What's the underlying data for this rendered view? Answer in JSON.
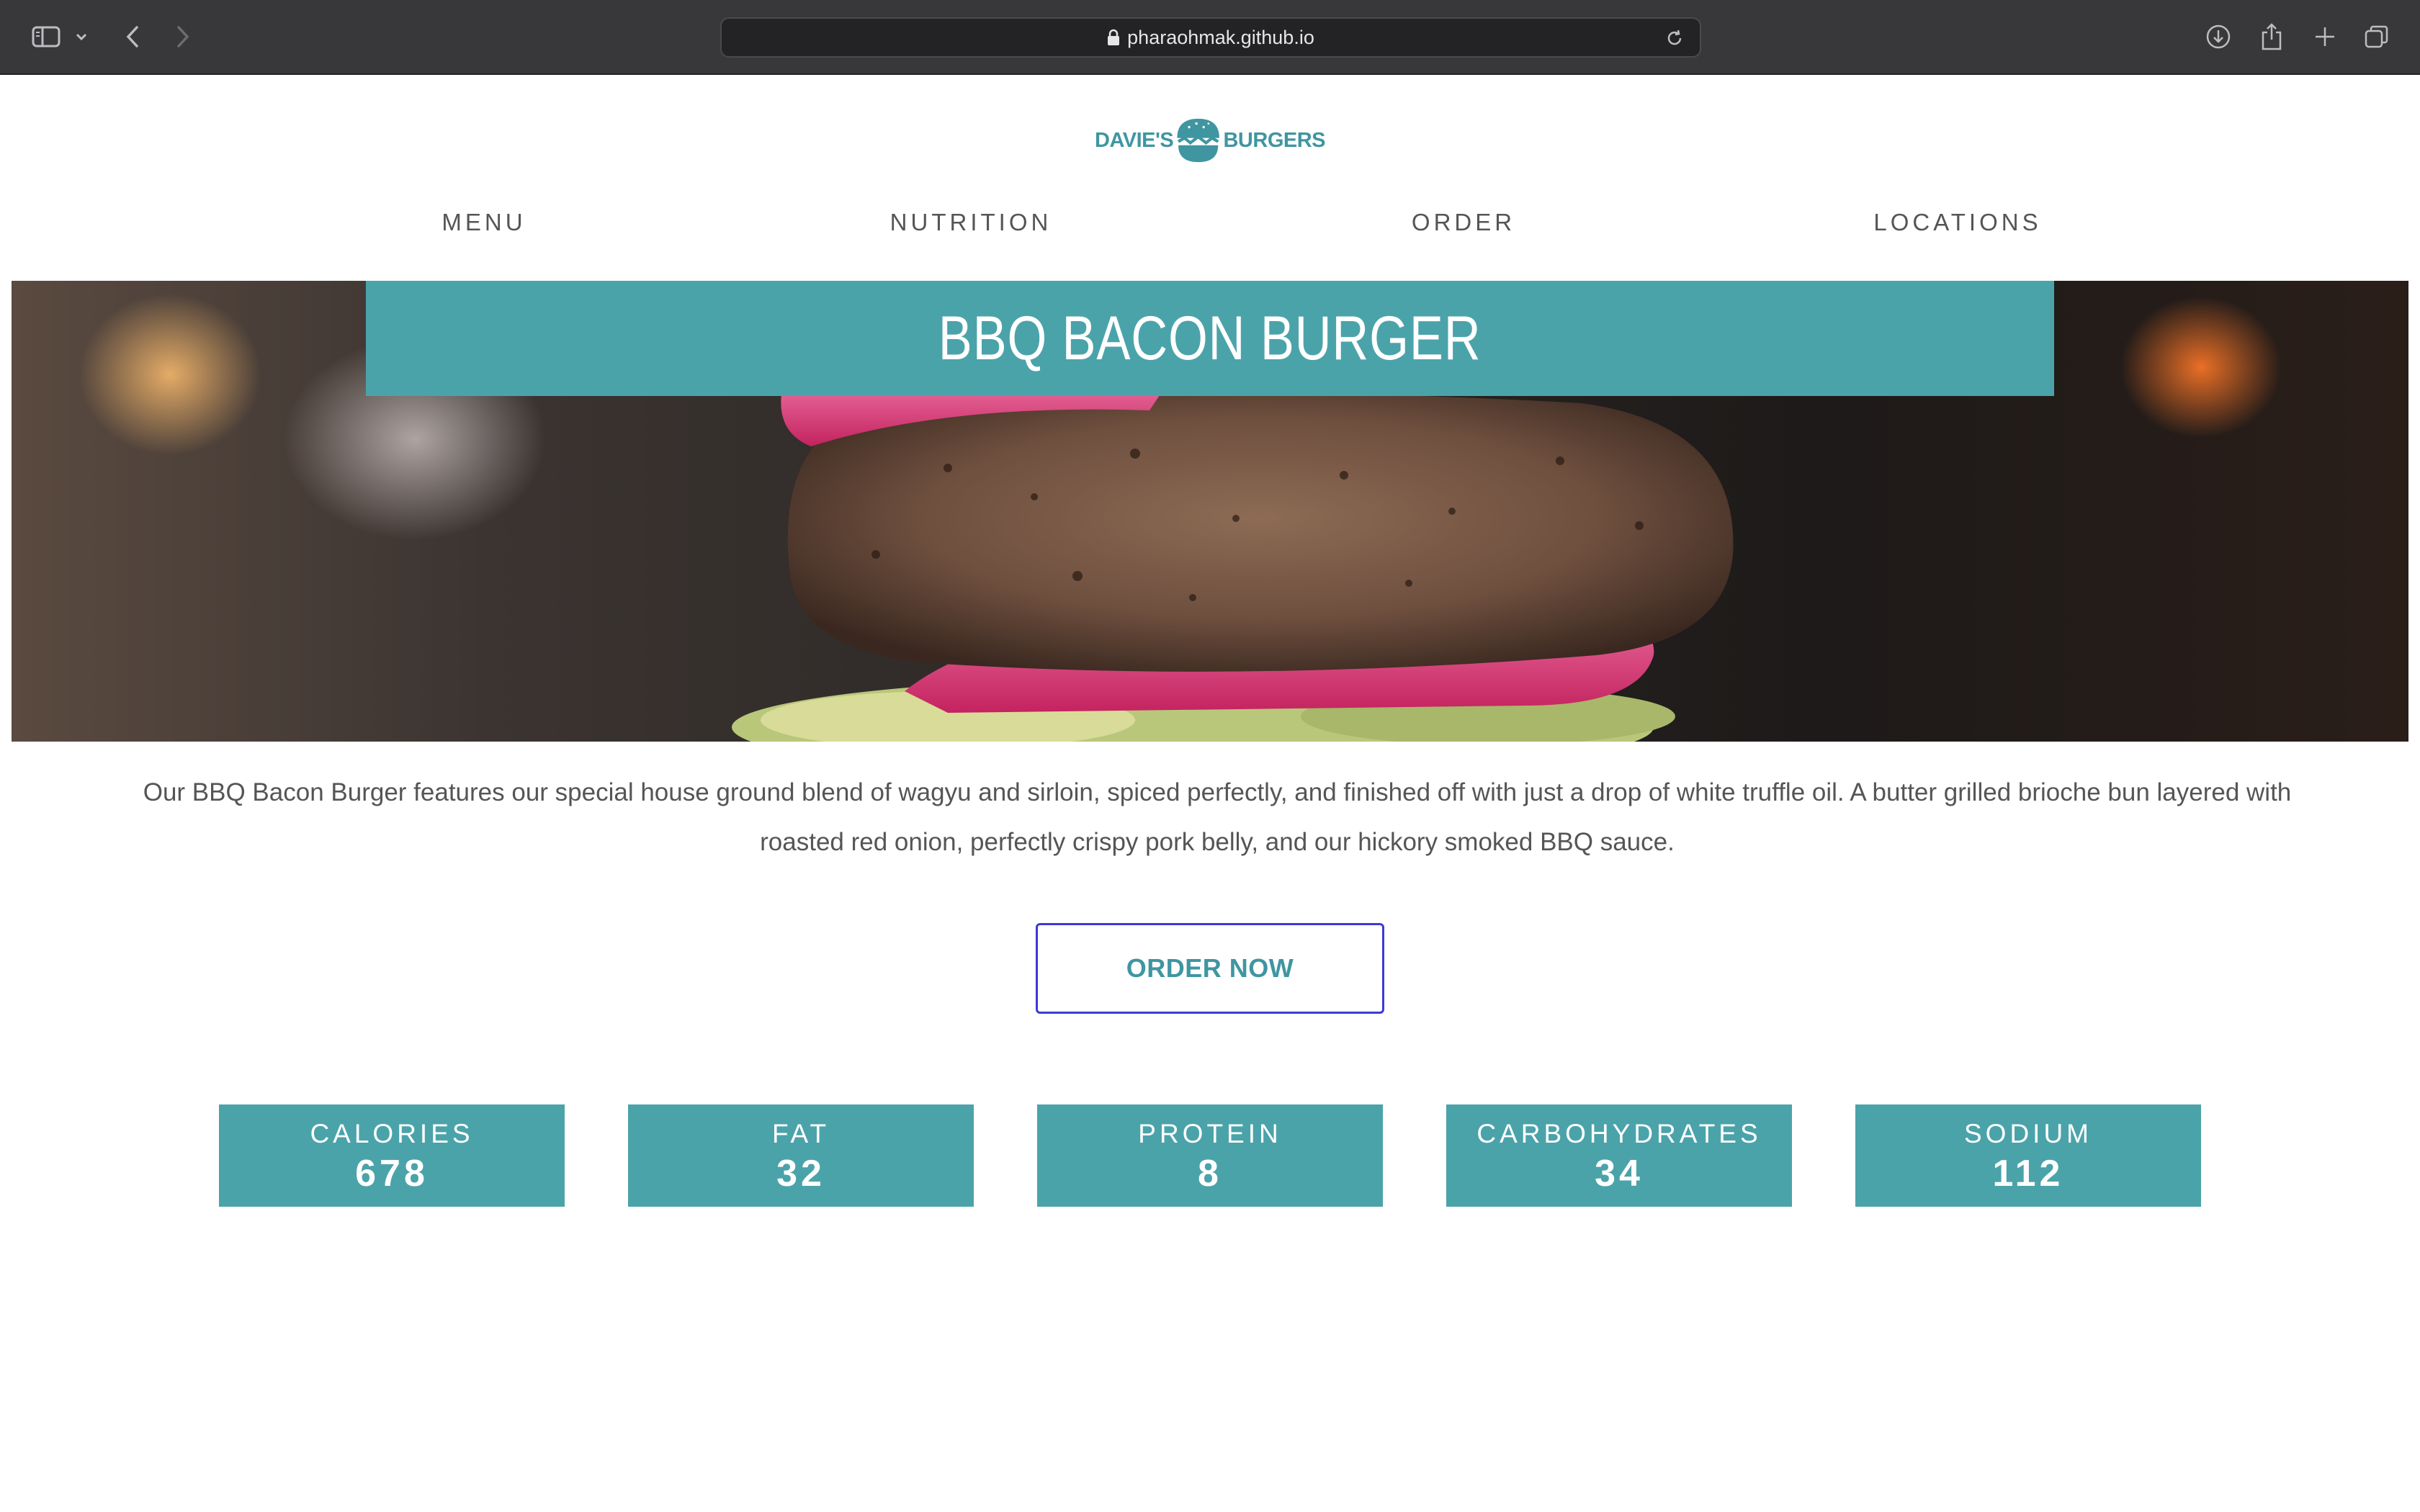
{
  "browser": {
    "url": "pharaohmak.github.io"
  },
  "logo": {
    "left_text": "DAVIE'S",
    "right_text": "BURGERS"
  },
  "nav": {
    "items": [
      {
        "label": "MENU"
      },
      {
        "label": "NUTRITION"
      },
      {
        "label": "ORDER"
      },
      {
        "label": "LOCATIONS"
      }
    ]
  },
  "hero": {
    "title": "BBQ BACON BURGER"
  },
  "description": "Our BBQ Bacon Burger features our special house ground blend of wagyu and sirloin, spiced perfectly, and finished off with just a drop of white truffle oil. A butter grilled brioche bun layered with roasted red onion, perfectly crispy pork belly, and our hickory smoked BBQ sauce.",
  "order_button": {
    "label": "ORDER NOW"
  },
  "nutrition": [
    {
      "label": "CALORIES",
      "value": "678"
    },
    {
      "label": "FAT",
      "value": "32"
    },
    {
      "label": "PROTEIN",
      "value": "8"
    },
    {
      "label": "CARBOHYDRATES",
      "value": "34"
    },
    {
      "label": "SODIUM",
      "value": "112"
    }
  ],
  "colors": {
    "brand_teal": "#4ba3aa",
    "logo_teal": "#3f96a1",
    "button_border": "#3b3bd6",
    "chrome_bg": "#38383a"
  },
  "icons": {
    "sidebar": "sidebar-icon",
    "back": "chevron-left-icon",
    "forward": "chevron-right-icon",
    "lock": "lock-icon",
    "reload": "reload-icon",
    "download": "download-icon",
    "share": "share-icon",
    "new_tab": "plus-icon",
    "tabs": "tabs-overview-icon"
  }
}
